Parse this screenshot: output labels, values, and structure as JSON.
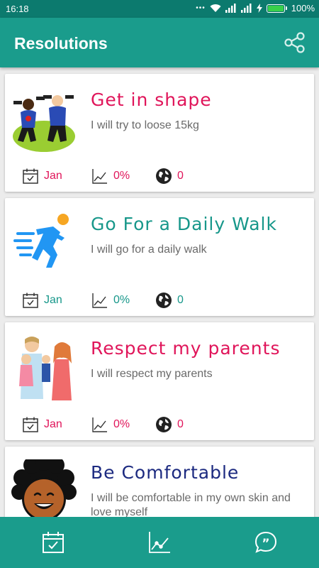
{
  "status": {
    "time": "16:18",
    "battery": "100%"
  },
  "appbar": {
    "title": "Resolutions",
    "share_icon": "share-icon"
  },
  "cards": [
    {
      "title": "Get in shape",
      "description": "I will try to loose 15kg",
      "month": "Jan",
      "progress": "0%",
      "shares": "0",
      "accent": "#e0155a"
    },
    {
      "title": "Go For a Daily Walk",
      "description": "I will go for a daily walk",
      "month": "Jan",
      "progress": "0%",
      "shares": "0",
      "accent": "#17978a"
    },
    {
      "title": "Respect my parents",
      "description": "I will respect my parents",
      "month": "Jan",
      "progress": "0%",
      "shares": "0",
      "accent": "#e0155a"
    },
    {
      "title": "Be Comfortable",
      "description": "I will be comfortable in my own skin and love myself",
      "accent": "#1c2a80"
    }
  ],
  "bottom_nav": [
    "calendar-check-icon",
    "chart-line-icon",
    "quote-bubble-icon"
  ],
  "colors": {
    "primary": "#1a9c8c",
    "status_bar": "#0c7a6e",
    "background": "#ececec"
  }
}
